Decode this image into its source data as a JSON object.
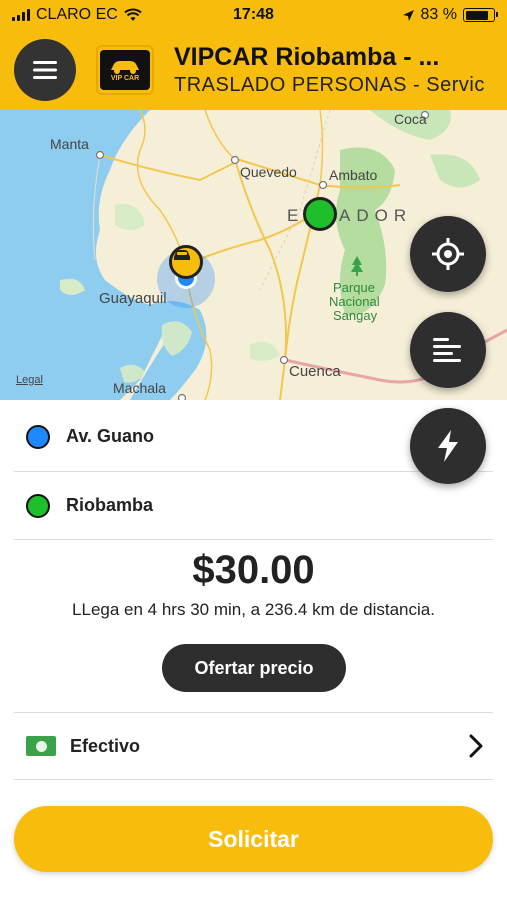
{
  "status_bar": {
    "carrier": "CLARO EC",
    "time": "17:48",
    "battery": "83 %",
    "battery_level": 0.83
  },
  "header": {
    "title": "VIPCAR Riobamba - ...",
    "subtitle": "TRASLADO PERSONAS - Servic",
    "logo_text": "VIP CAR"
  },
  "map": {
    "labels": {
      "manta": "Manta",
      "quevedo": "Quevedo",
      "coca": "Coca",
      "ambato": "Ambato",
      "country": "E",
      "country_rest": "ADOR",
      "guayaquil": "Guayaquil",
      "parque": "Parque",
      "nacional": "Nacional",
      "sangay": "Sangay",
      "cuenca": "Cuenca",
      "machala": "Machala"
    },
    "legal": "Legal"
  },
  "route": {
    "origin": "Av. Guano",
    "destination": "Riobamba"
  },
  "trip": {
    "price": "$30.00",
    "eta": "LLega en 4 hrs 30 min, a 236.4 km de distancia."
  },
  "offer_button": "Ofertar precio",
  "payment": {
    "method": "Efectivo"
  },
  "request_button": "Solicitar",
  "colors": {
    "accent": "#f8bd0c",
    "dark": "#2e2e2e",
    "origin_dot": "#1e88ff",
    "destination_dot": "#1fbf2c",
    "cash": "#3aa34a"
  },
  "icons": {
    "menu": "hamburger-menu-icon",
    "locate": "crosshair-locate-icon",
    "list": "align-left-list-icon",
    "flash": "lightning-bolt-icon",
    "taxi": "taxi-car-icon",
    "cash": "cash-banknote-icon",
    "chevron": "chevron-right-icon"
  }
}
